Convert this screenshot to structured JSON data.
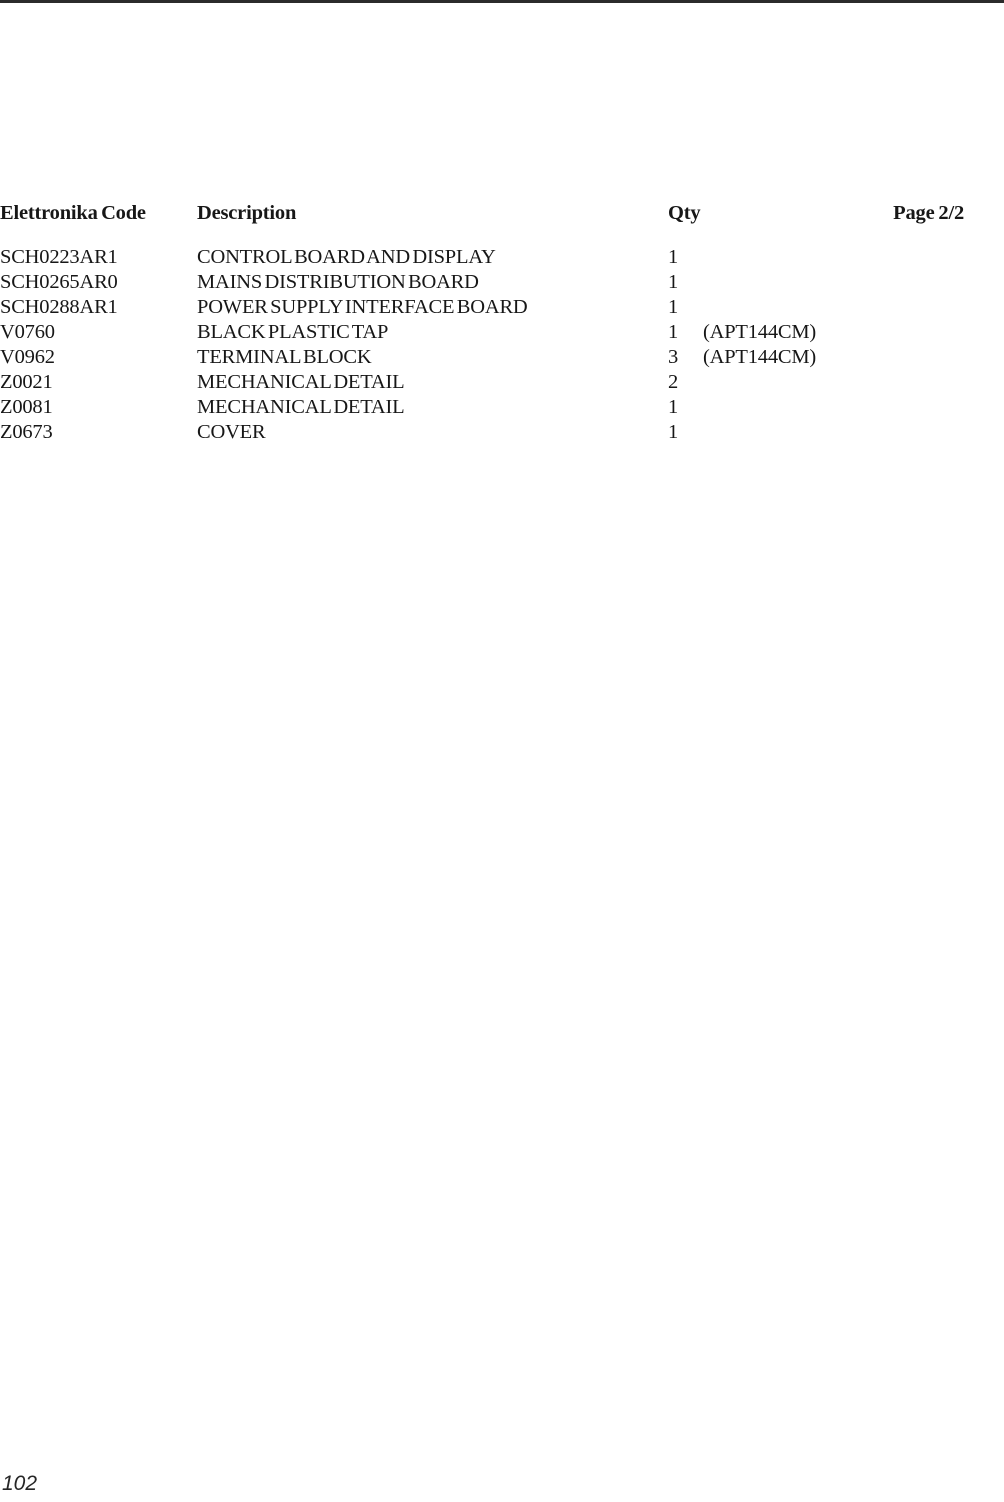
{
  "document": {
    "top_rule_color": "#2b2b2b",
    "text_color": "#171717"
  },
  "header": {
    "code_label": "Elettronika Code",
    "description_label": "Description",
    "qty_label": "Qty",
    "page_label": "Page 2/2"
  },
  "rows": [
    {
      "code": "SCH0223AR1",
      "description": "CONTROL BOARD AND DISPLAY",
      "qty": "1",
      "note": ""
    },
    {
      "code": "SCH0265AR0",
      "description": "MAINS DISTRIBUTION BOARD",
      "qty": "1",
      "note": ""
    },
    {
      "code": "SCH0288AR1",
      "description": "POWER SUPPLY INTERFACE BOARD",
      "qty": "1",
      "note": ""
    },
    {
      "code": "V0760",
      "description": "BLACK PLASTIC TAP",
      "qty": "1",
      "note": "(APT144CM)"
    },
    {
      "code": "V0962",
      "description": "TERMINAL BLOCK",
      "qty": "3",
      "note": "(APT144CM)"
    },
    {
      "code": "Z0021",
      "description": "MECHANICAL DETAIL",
      "qty": "2",
      "note": ""
    },
    {
      "code": "Z0081",
      "description": "MECHANICAL DETAIL",
      "qty": "1",
      "note": ""
    },
    {
      "code": "Z0673",
      "description": "COVER",
      "qty": "1",
      "note": ""
    }
  ],
  "footer": {
    "page_number": "102"
  }
}
